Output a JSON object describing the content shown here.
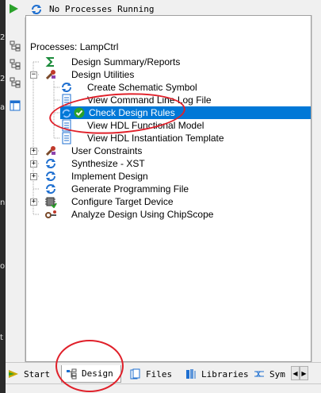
{
  "toolbar": {
    "status_text": "No Processes Running",
    "run_icon": "green-play-icon",
    "refresh_icon": "refresh-icon"
  },
  "left_edge_chars": [
    "2",
    "2",
    "a",
    "n",
    "o",
    "t"
  ],
  "processes": {
    "header": "Processes: LampCtrl",
    "items": [
      {
        "label": "Design Summary/Reports",
        "icon": "sigma-icon"
      },
      {
        "label": "Design Utilities",
        "icon": "tools-icon"
      },
      {
        "label": "Create Schematic Symbol",
        "icon": "refresh-icon"
      },
      {
        "label": "View Command Line Log File",
        "icon": "document-icon"
      },
      {
        "label": "Check Design Rules",
        "icon": "check-icon"
      },
      {
        "label": "View HDL Functional Model",
        "icon": "document-icon"
      },
      {
        "label": "View HDL Instantiation Template",
        "icon": "document-icon"
      },
      {
        "label": "User Constraints",
        "icon": "tools-icon"
      },
      {
        "label": "Synthesize - XST",
        "icon": "refresh-icon"
      },
      {
        "label": "Implement Design",
        "icon": "refresh-icon"
      },
      {
        "label": "Generate Programming File",
        "icon": "refresh-icon"
      },
      {
        "label": "Configure Target Device",
        "icon": "chip-icon"
      },
      {
        "label": "Analyze Design Using ChipScope",
        "icon": "scope-icon"
      }
    ]
  },
  "tabs": [
    {
      "label": "Start",
      "icon": "start-icon"
    },
    {
      "label": "Design",
      "icon": "design-icon"
    },
    {
      "label": "Files",
      "icon": "files-icon"
    },
    {
      "label": "Libraries",
      "icon": "libraries-icon"
    },
    {
      "label": "Sym",
      "icon": "symbols-icon"
    }
  ],
  "colors": {
    "selection": "#0078d7",
    "annotation": "#e0202a",
    "run_green": "#2aa12a"
  }
}
